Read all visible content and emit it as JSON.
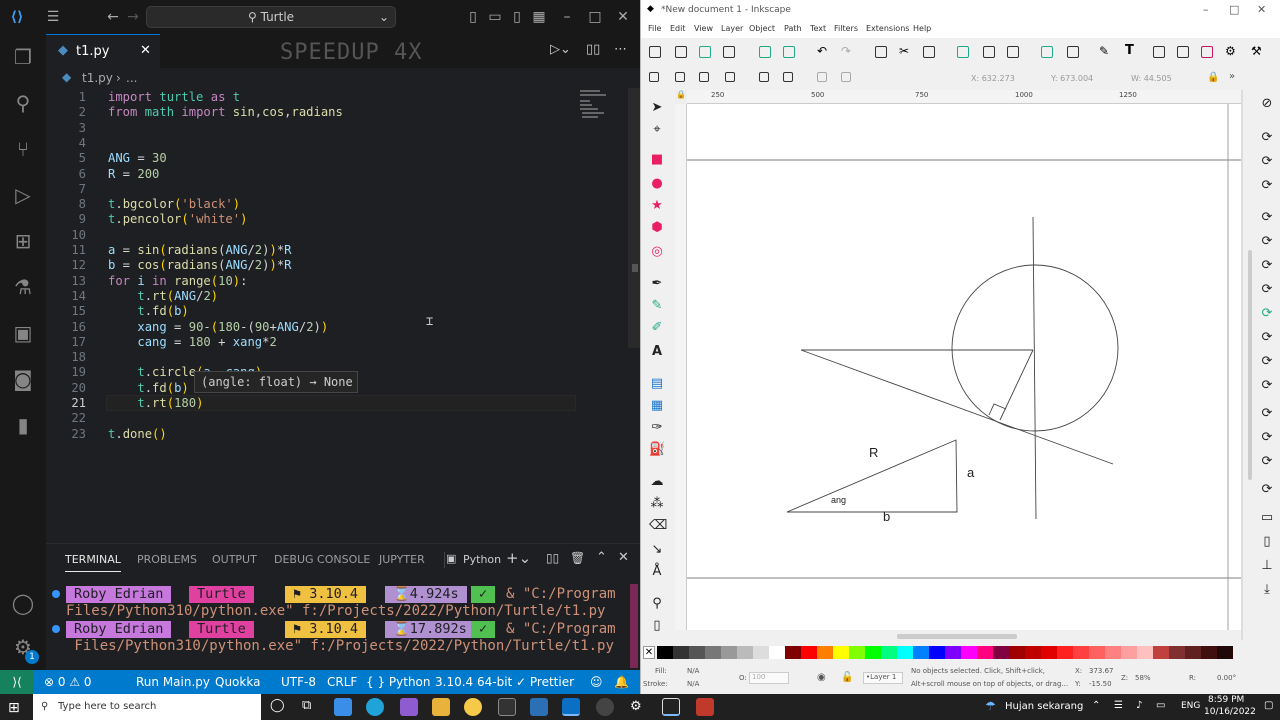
{
  "vscode": {
    "search": "Turtle",
    "tab_name": "t1.py",
    "breadcrumb": "t1.py",
    "breadcrumb_more": "...",
    "overlay_text": "SPEEDUP 4X",
    "code_lines": [
      {
        "n": "1",
        "html": "<span class='kw'>import</span> <span class='cls'>turtle</span> <span class='kw'>as</span> <span class='cls'>t</span>"
      },
      {
        "n": "2",
        "html": "<span class='kw'>from</span> <span class='cls'>math</span> <span class='kw'>import</span> <span class='fn'>sin</span>,<span class='fn'>cos</span>,<span class='fn'>radians</span>"
      },
      {
        "n": "3",
        "html": ""
      },
      {
        "n": "4",
        "html": ""
      },
      {
        "n": "5",
        "html": "<span class='var'>ANG</span> = <span class='num'>30</span>"
      },
      {
        "n": "6",
        "html": "<span class='var'>R</span> = <span class='num'>200</span>"
      },
      {
        "n": "7",
        "html": ""
      },
      {
        "n": "8",
        "html": "<span class='cls'>t</span>.<span class='fn'>bgcolor</span><span class='pn'>(</span><span class='str'>'black'</span><span class='pn'>)</span>"
      },
      {
        "n": "9",
        "html": "<span class='cls'>t</span>.<span class='fn'>pencolor</span><span class='pn'>(</span><span class='str'>'white'</span><span class='pn'>)</span>"
      },
      {
        "n": "10",
        "html": ""
      },
      {
        "n": "11",
        "html": "<span class='var'>a</span> = <span class='fn'>sin</span><span class='pn'>(</span><span class='fn'>radians</span>(<span class='var'>ANG</span>/<span class='num'>2</span>)<span class='pn'>)</span>*<span class='var'>R</span>"
      },
      {
        "n": "12",
        "html": "<span class='var'>b</span> = <span class='fn'>cos</span><span class='pn'>(</span><span class='fn'>radians</span>(<span class='var'>ANG</span>/<span class='num'>2</span>)<span class='pn'>)</span>*<span class='var'>R</span>"
      },
      {
        "n": "13",
        "html": "<span class='kw'>for</span> <span class='var'>i</span> <span class='kw'>in</span> <span class='fn'>range</span><span class='pn'>(</span><span class='num'>10</span><span class='pn'>)</span>:"
      },
      {
        "n": "14",
        "html": "    <span class='cls'>t</span>.<span class='fn'>rt</span><span class='pn'>(</span><span class='var'>ANG</span>/<span class='num'>2</span><span class='pn'>)</span>"
      },
      {
        "n": "15",
        "html": "    <span class='cls'>t</span>.<span class='fn'>fd</span><span class='pn'>(</span><span class='var'>b</span><span class='pn'>)</span>"
      },
      {
        "n": "16",
        "html": "    <span class='var'>xang</span> = <span class='num'>90</span>-<span class='pn'>(</span><span class='num'>180</span>-(<span class='num'>90</span>+<span class='var'>ANG</span>/<span class='num'>2</span>)<span class='pn'>)</span>"
      },
      {
        "n": "17",
        "html": "    <span class='var'>cang</span> = <span class='num'>180</span> + <span class='var'>xang</span>*<span class='num'>2</span>"
      },
      {
        "n": "18",
        "html": ""
      },
      {
        "n": "19",
        "html": "    <span class='cls'>t</span>.<span class='fn'>circle</span><span class='pn'>(</span><span class='var'>a</span>, <span class='var'>cang</span><span class='pn'>)</span>"
      },
      {
        "n": "20",
        "html": "    <span class='cls'>t</span>.<span class='fn'>fd</span><span class='pn'>(</span><span class='var'>b</span><span class='pn'>)</span>"
      },
      {
        "n": "21",
        "html": "    <span class='cls'>t</span>.<span class='fn'>rt</span><span class='pn'>(</span><span class='num'>180</span><span class='pn'>)</span>"
      },
      {
        "n": "22",
        "html": ""
      },
      {
        "n": "23",
        "html": "<span class='cls'>t</span>.<span class='fn'>done</span><span class='pn'>()</span>"
      }
    ],
    "tooltip": "(angle: float) → None",
    "panel_tabs": [
      "TERMINAL",
      "PROBLEMS",
      "OUTPUT",
      "DEBUG CONSOLE",
      "JUPYTER"
    ],
    "panel_python": "Python",
    "terminal": [
      {
        "user": "Roby Edrian",
        "folder": "Turtle",
        "py": "⚑ 3.10.4",
        "time": "⌛4.924s",
        "cmd1": "& \"C:/Program",
        "cmd2": "Files/Python310/python.exe\" f:/Projects/2022/Python/Turtle/t1.py"
      },
      {
        "user": "Roby Edrian",
        "folder": "Turtle",
        "py": "⚑ 3.10.4",
        "time": "⌛17.892s",
        "cmd1": "& \"C:/Program",
        "cmd2": " Files/Python310/python.exe\" f:/Projects/2022/Python/Turtle/t1.py"
      }
    ],
    "status": {
      "errors": "⊗ 0 ⚠ 0",
      "run": "Run Main.py",
      "quokka": "Quokka",
      "encoding": "UTF-8",
      "eol": "CRLF",
      "lang": "{ } Python",
      "version": "3.10.4 64-bit",
      "prettier": "✓ Prettier"
    }
  },
  "inkscape": {
    "title": "*New document 1 - Inkscape",
    "menu": [
      "File",
      "Edit",
      "View",
      "Layer",
      "Object",
      "Path",
      "Text",
      "Filters",
      "Extensions",
      "Help"
    ],
    "ctrl": {
      "x": "632.273",
      "y": "673.004",
      "w": "44.505"
    },
    "ruler_ticks": [
      "250",
      "500",
      "750",
      "1000",
      "1250"
    ],
    "labels": {
      "R": "R",
      "a": "a",
      "ang": "ang",
      "b": "b"
    },
    "status": {
      "fill_label": "Fill:",
      "fill_value": "N/A",
      "stroke_label": "Stroke:",
      "stroke_value": "N/A",
      "opacity_label": "O:",
      "opacity_value": "100",
      "layer": "•Layer 1",
      "message1": "No objects selected. Click, Shift+click,",
      "message2": "Alt+scroll mouse on top of objects, or drag...",
      "x": "373.67",
      "y": "-15.50",
      "zoom": "58%",
      "rotation": "0.00°"
    },
    "palette": [
      "#000000",
      "#333333",
      "#555555",
      "#777777",
      "#999999",
      "#bbbbbb",
      "#dddddd",
      "#ffffff",
      "#800000",
      "#ff0000",
      "#ff8000",
      "#ffff00",
      "#80ff00",
      "#00ff00",
      "#00ff80",
      "#00ffff",
      "#0080ff",
      "#0000ff",
      "#8000ff",
      "#ff00ff",
      "#ff0080",
      "#800040",
      "#a00000",
      "#c00000",
      "#e00000",
      "#ff2020",
      "#ff4040",
      "#ff6060",
      "#ff8080",
      "#ffa0a0",
      "#ffc0c0",
      "#c04040",
      "#803030",
      "#602020",
      "#401010",
      "#200808"
    ]
  },
  "taskbar": {
    "search_placeholder": "Type here to search",
    "weather": "Hujan sekarang",
    "lang": "ENG",
    "time": "8:59 PM",
    "date": "10/16/2022"
  }
}
